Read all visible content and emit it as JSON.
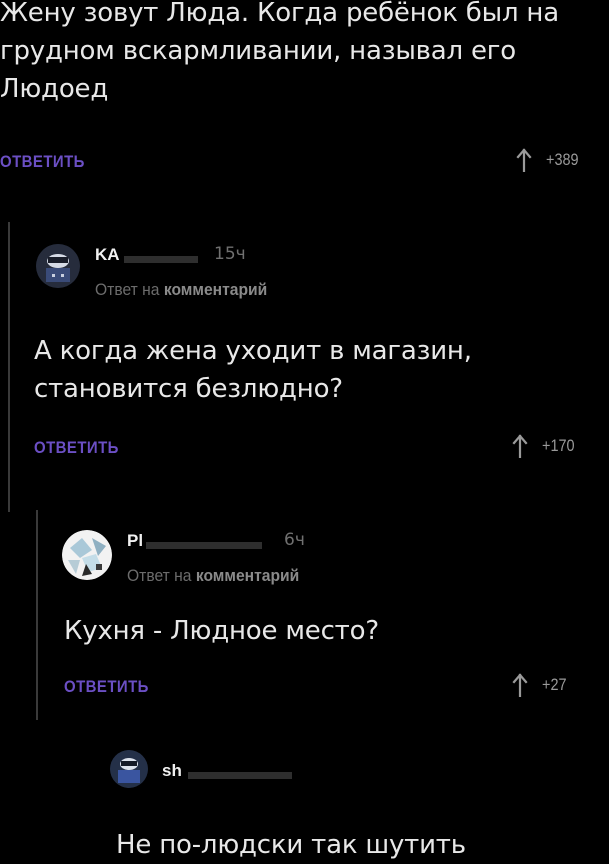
{
  "comments": [
    {
      "text_lines": [
        "Жену зовут Люда. Когда ребёнок был на",
        "грудном вскармливании, называл его",
        "Людоед"
      ],
      "reply_label": "ОТВЕТИТЬ",
      "votes": "+389"
    },
    {
      "author": "KA",
      "time": "15ч",
      "reply_note_prefix": "Ответ на",
      "reply_note_link": "комментарий",
      "text_lines": [
        "А когда жена уходит в магазин,",
        "становится безлюдно?"
      ],
      "reply_label": "ОТВЕТИТЬ",
      "votes": "+170"
    },
    {
      "author": "Pl",
      "time": "6ч",
      "reply_note_prefix": "Ответ на",
      "reply_note_link": "комментарий",
      "text_lines": [
        "Кухня - Людное место?"
      ],
      "reply_label": "ОТВЕТИТЬ",
      "votes": "+27"
    },
    {
      "author": "sh",
      "text_lines": [
        "Не по-людски так шутить"
      ]
    }
  ],
  "colors": {
    "background": "#000000",
    "reply_link": "#6b4fc4",
    "text": "#e8e8e8",
    "meta": "#707070"
  },
  "icons": {
    "upvote": "arrow-up-icon",
    "avatar": "user-avatar-icon"
  }
}
